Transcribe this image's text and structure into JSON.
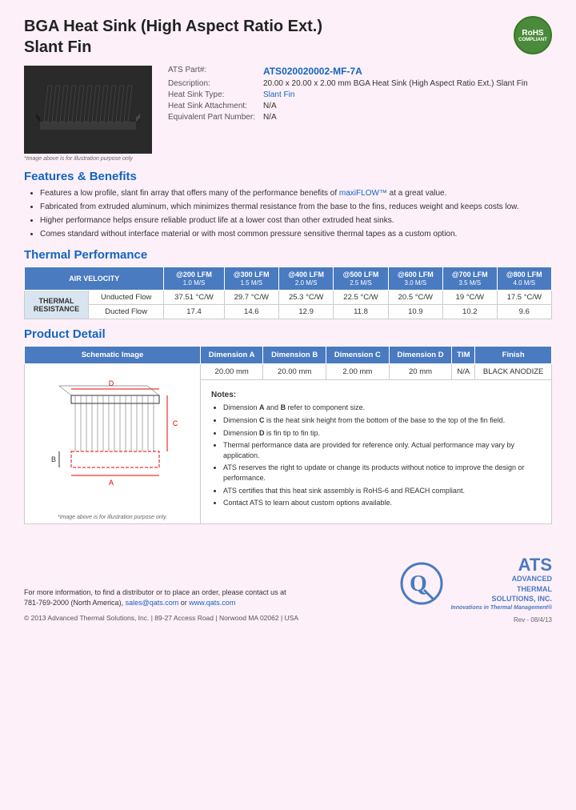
{
  "page": {
    "background": "#fdf0f8"
  },
  "header": {
    "title_line1": "BGA Heat Sink (High Aspect Ratio Ext.)",
    "title_line2": "Slant Fin",
    "rohs": {
      "line1": "RoHS",
      "line2": "COMPLIANT"
    }
  },
  "specs": {
    "part_label": "ATS Part#:",
    "part_value": "ATS020020002-MF-7A",
    "description_label": "Description:",
    "description_value": "20.00 x 20.00 x 2.00 mm  BGA Heat Sink (High Aspect Ratio Ext.) Slant Fin",
    "type_label": "Heat Sink Type:",
    "type_value": "Slant Fin",
    "attachment_label": "Heat Sink Attachment:",
    "attachment_value": "N/A",
    "equiv_label": "Equivalent Part Number:",
    "equiv_value": "N/A"
  },
  "image_note": "*Image above is for illustration purpose only",
  "features": {
    "section_title": "Features & Benefits",
    "items": [
      "Features a low profile, slant fin array that offers many of the performance benefits of maxiFLOW™ at a great value.",
      "Fabricated from extruded aluminum, which minimizes thermal resistance from the base to the fins, reduces weight and keeps costs low.",
      "Higher performance helps ensure reliable product life at a lower cost than other extruded heat sinks.",
      "Comes standard without interface material or with most common pressure sensitive thermal tapes as a custom option."
    ],
    "highlight_text": "maxiFLOW™"
  },
  "thermal": {
    "section_title": "Thermal Performance",
    "col_header_label": "AIR VELOCITY",
    "columns": [
      {
        "lfm": "@200 LFM",
        "ms": "1.0 M/S"
      },
      {
        "lfm": "@300 LFM",
        "ms": "1.5 M/S"
      },
      {
        "lfm": "@400 LFM",
        "ms": "2.0 M/S"
      },
      {
        "lfm": "@500 LFM",
        "ms": "2.5 M/S"
      },
      {
        "lfm": "@600 LFM",
        "ms": "3.0 M/S"
      },
      {
        "lfm": "@700 LFM",
        "ms": "3.5 M/S"
      },
      {
        "lfm": "@800 LFM",
        "ms": "4.0 M/S"
      }
    ],
    "row_header": "THERMAL RESISTANCE",
    "rows": [
      {
        "label": "Unducted Flow",
        "values": [
          "37.51 °C/W",
          "29.7 °C/W",
          "25.3 °C/W",
          "22.5 °C/W",
          "20.5 °C/W",
          "19 °C/W",
          "17.5 °C/W"
        ]
      },
      {
        "label": "Ducted Flow",
        "values": [
          "17.4",
          "14.6",
          "12.9",
          "11.8",
          "10.9",
          "10.2",
          "9.6"
        ]
      }
    ]
  },
  "product_detail": {
    "section_title": "Product Detail",
    "table_headers": [
      "Schematic Image",
      "Dimension A",
      "Dimension B",
      "Dimension C",
      "Dimension D",
      "TIM",
      "Finish"
    ],
    "dimension_values": [
      "20.00 mm",
      "20.00 mm",
      "2.00 mm",
      "20 mm",
      "N/A",
      "BLACK ANODIZE"
    ],
    "notes_title": "Notes:",
    "notes": [
      "Dimension A and B refer to component size.",
      "Dimension C is the heat sink height from the bottom of the base to the top of the fin field.",
      "Dimension D is fin tip to fin tip.",
      "Thermal performance data are provided for reference only. Actual performance may vary by application.",
      "ATS reserves the right to update or change its products without notice to improve the design or performance.",
      "ATS certifies that this heat sink assembly is RoHS-6 and REACH compliant.",
      "Contact ATS to learn about custom options available."
    ],
    "schematic_note": "*Image above is for illustration purpose only."
  },
  "footer": {
    "contact_text": "For more information, to find a distributor or to place an order, please contact us at",
    "phone": "781-769-2000 (North America),",
    "email": "sales@qats.com",
    "or": "or",
    "website": "www.qats.com",
    "copyright": "© 2013 Advanced Thermal Solutions, Inc.  |  89-27 Access Road  |  Norwood MA  02062  |  USA",
    "ats_name_line1": "ADVANCED",
    "ats_name_line2": "THERMAL",
    "ats_name_line3": "SOLUTIONS, INC.",
    "tagline": "Innovations in Thermal Management®",
    "rev": "Rev - 08/4/13"
  }
}
